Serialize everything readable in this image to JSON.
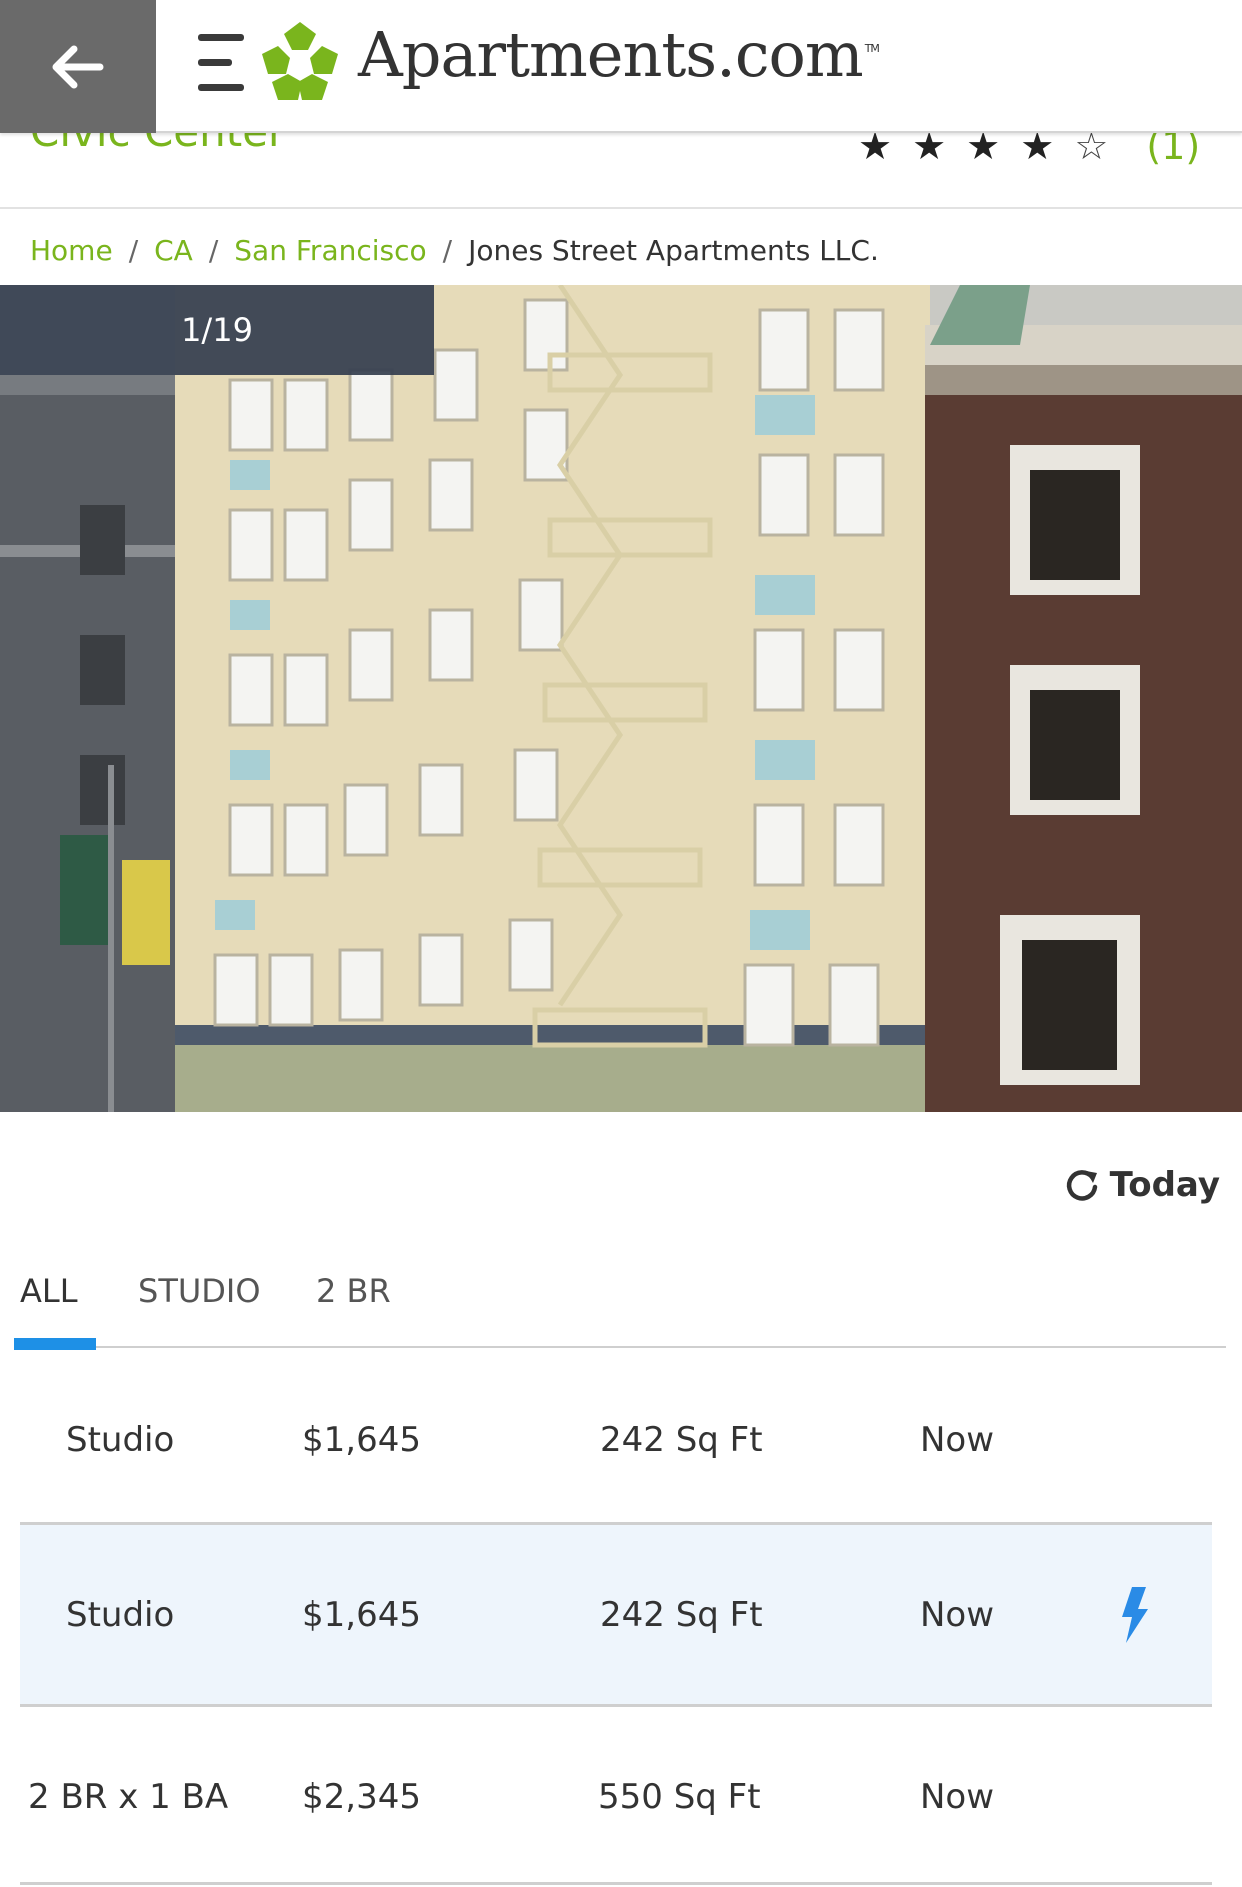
{
  "header": {
    "logo_text": "Apartments.com",
    "logo_trademark": "TM"
  },
  "listing": {
    "neighborhood": "Civic Center",
    "rating_stars": 4,
    "rating_max": 5,
    "review_count": "(1)"
  },
  "breadcrumb": {
    "items": [
      "Home",
      "CA",
      "San Francisco"
    ],
    "current": "Jones Street Apartments LLC."
  },
  "gallery": {
    "counter": "1/19",
    "current_index": 1,
    "total": 19
  },
  "refresh": {
    "label": "Today"
  },
  "tabs": [
    {
      "label": "ALL",
      "active": true
    },
    {
      "label": "STUDIO",
      "active": false
    },
    {
      "label": "2 BR",
      "active": false
    }
  ],
  "units": [
    {
      "type": "Studio",
      "price": "$1,645",
      "size": "242 Sq Ft",
      "available": "Now",
      "highlight": false,
      "instant": false
    },
    {
      "type": "Studio",
      "price": "$1,645",
      "size": "242 Sq Ft",
      "available": "Now",
      "highlight": true,
      "instant": true
    },
    {
      "type": "2 BR x 1 BA",
      "price": "$2,345",
      "size": "550 Sq Ft",
      "available": "Now",
      "highlight": false,
      "instant": false
    }
  ],
  "colors": {
    "brand_green": "#7ab51d",
    "tab_accent": "#1e90e6",
    "bolt_blue": "#2a8be6",
    "highlight_row": "#eef5fc"
  }
}
